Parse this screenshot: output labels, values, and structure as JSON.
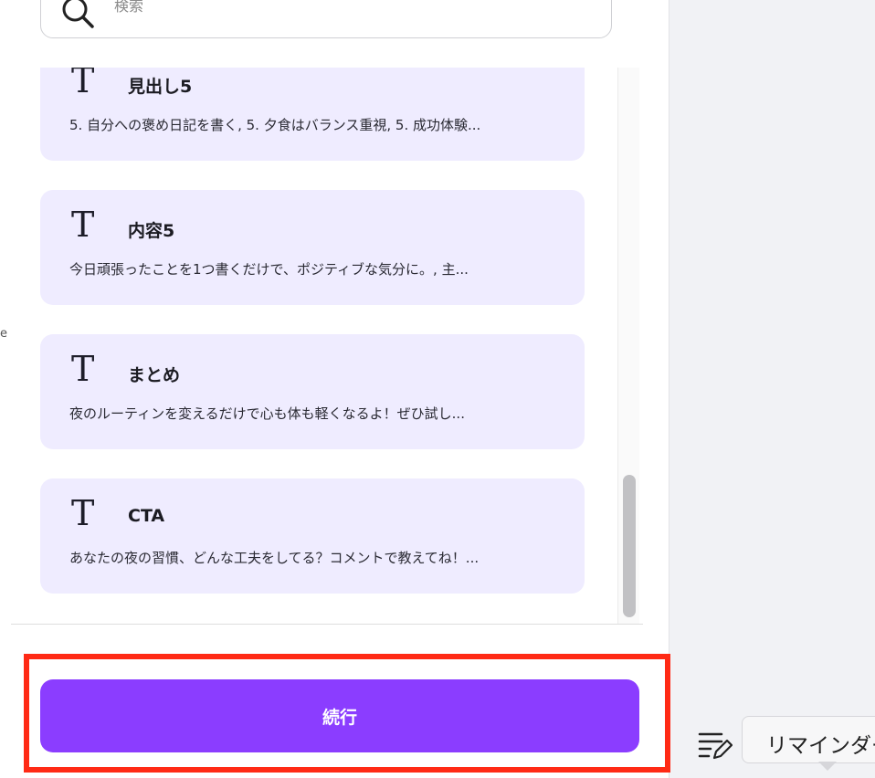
{
  "left_fragment": "e",
  "search": {
    "placeholder": "検索"
  },
  "cards": [
    {
      "title": "見出し5",
      "description": "5. 自分への褒め日記を書く, 5. 夕食はバランス重視, 5. 成功体験..."
    },
    {
      "title": "内容5",
      "description": "今日頑張ったことを1つ書くだけで、ポジティブな気分に。, 主..."
    },
    {
      "title": "まとめ",
      "description": "夜のルーティンを変えるだけで心も体も軽くなるよ！ぜひ試し..."
    },
    {
      "title": "CTA",
      "description": "あなたの夜の習慣、どんな工夫をしてる？コメントで教えてね！..."
    }
  ],
  "footer": {
    "continue_label": "続行"
  },
  "toolbar": {
    "reminder_label": "リマインダー"
  },
  "colors": {
    "card_bg": "#efecff",
    "primary": "#8b3dff",
    "highlight": "#ff2a15"
  }
}
